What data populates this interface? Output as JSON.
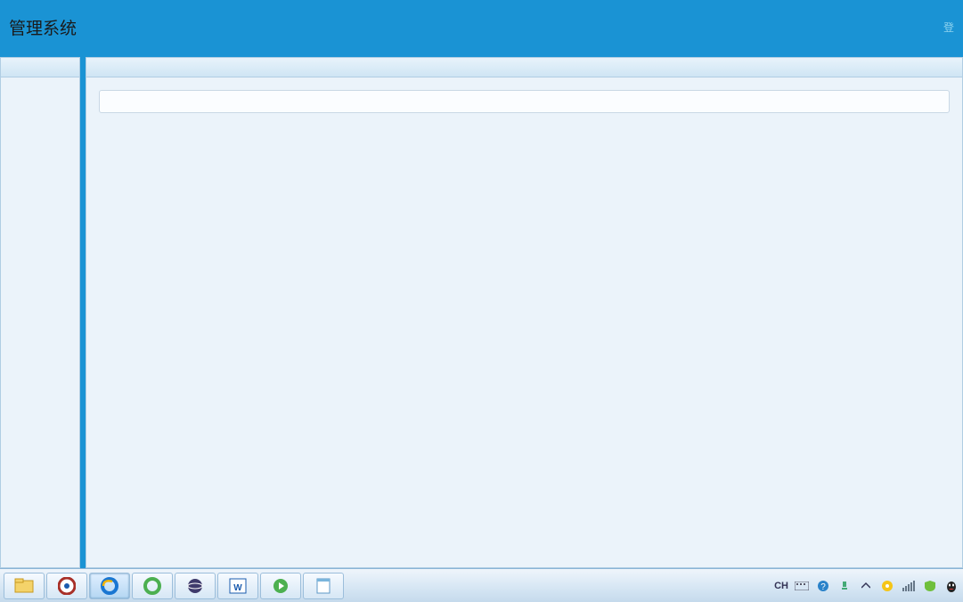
{
  "header": {
    "title": "管理系统",
    "right_text": "登"
  },
  "sidebar": {
    "items": [
      "",
      "",
      "",
      ""
    ]
  },
  "main": {
    "input_value": ""
  },
  "taskbar": {
    "buttons": [
      {
        "name": "explorer-icon"
      },
      {
        "name": "browser-icon"
      },
      {
        "name": "ie-icon"
      },
      {
        "name": "green-browser-icon"
      },
      {
        "name": "eclipse-icon"
      },
      {
        "name": "word-icon"
      },
      {
        "name": "media-icon"
      },
      {
        "name": "notepad-icon"
      }
    ],
    "tray": {
      "ime": "CH",
      "items": [
        "keyboard-icon",
        "help-icon",
        "network-icon",
        "chevron-icon",
        "shield-icon",
        "signal-icon",
        "defender-icon",
        "qq-icon"
      ]
    }
  }
}
